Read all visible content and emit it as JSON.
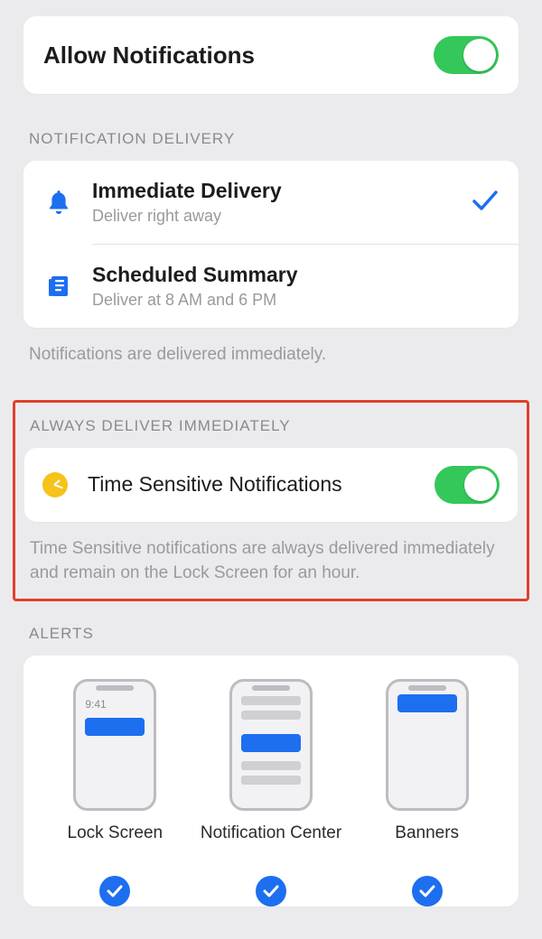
{
  "allow": {
    "label": "Allow Notifications",
    "enabled": true
  },
  "delivery": {
    "header": "NOTIFICATION DELIVERY",
    "options": [
      {
        "icon": "bell-icon",
        "title": "Immediate Delivery",
        "subtitle": "Deliver right away",
        "selected": true
      },
      {
        "icon": "summary-icon",
        "title": "Scheduled Summary",
        "subtitle": "Deliver at 8 AM and 6 PM",
        "selected": false
      }
    ],
    "footer": "Notifications are delivered immediately."
  },
  "time_sensitive": {
    "header": "ALWAYS DELIVER IMMEDIATELY",
    "label": "Time Sensitive Notifications",
    "enabled": true,
    "footer": "Time Sensitive notifications are always delivered immediately and remain on the Lock Screen for an hour."
  },
  "alerts": {
    "header": "ALERTS",
    "options": [
      {
        "label": "Lock Screen",
        "selected": true,
        "preview_time": "9:41"
      },
      {
        "label": "Notification Center",
        "selected": true
      },
      {
        "label": "Banners",
        "selected": true
      }
    ]
  }
}
